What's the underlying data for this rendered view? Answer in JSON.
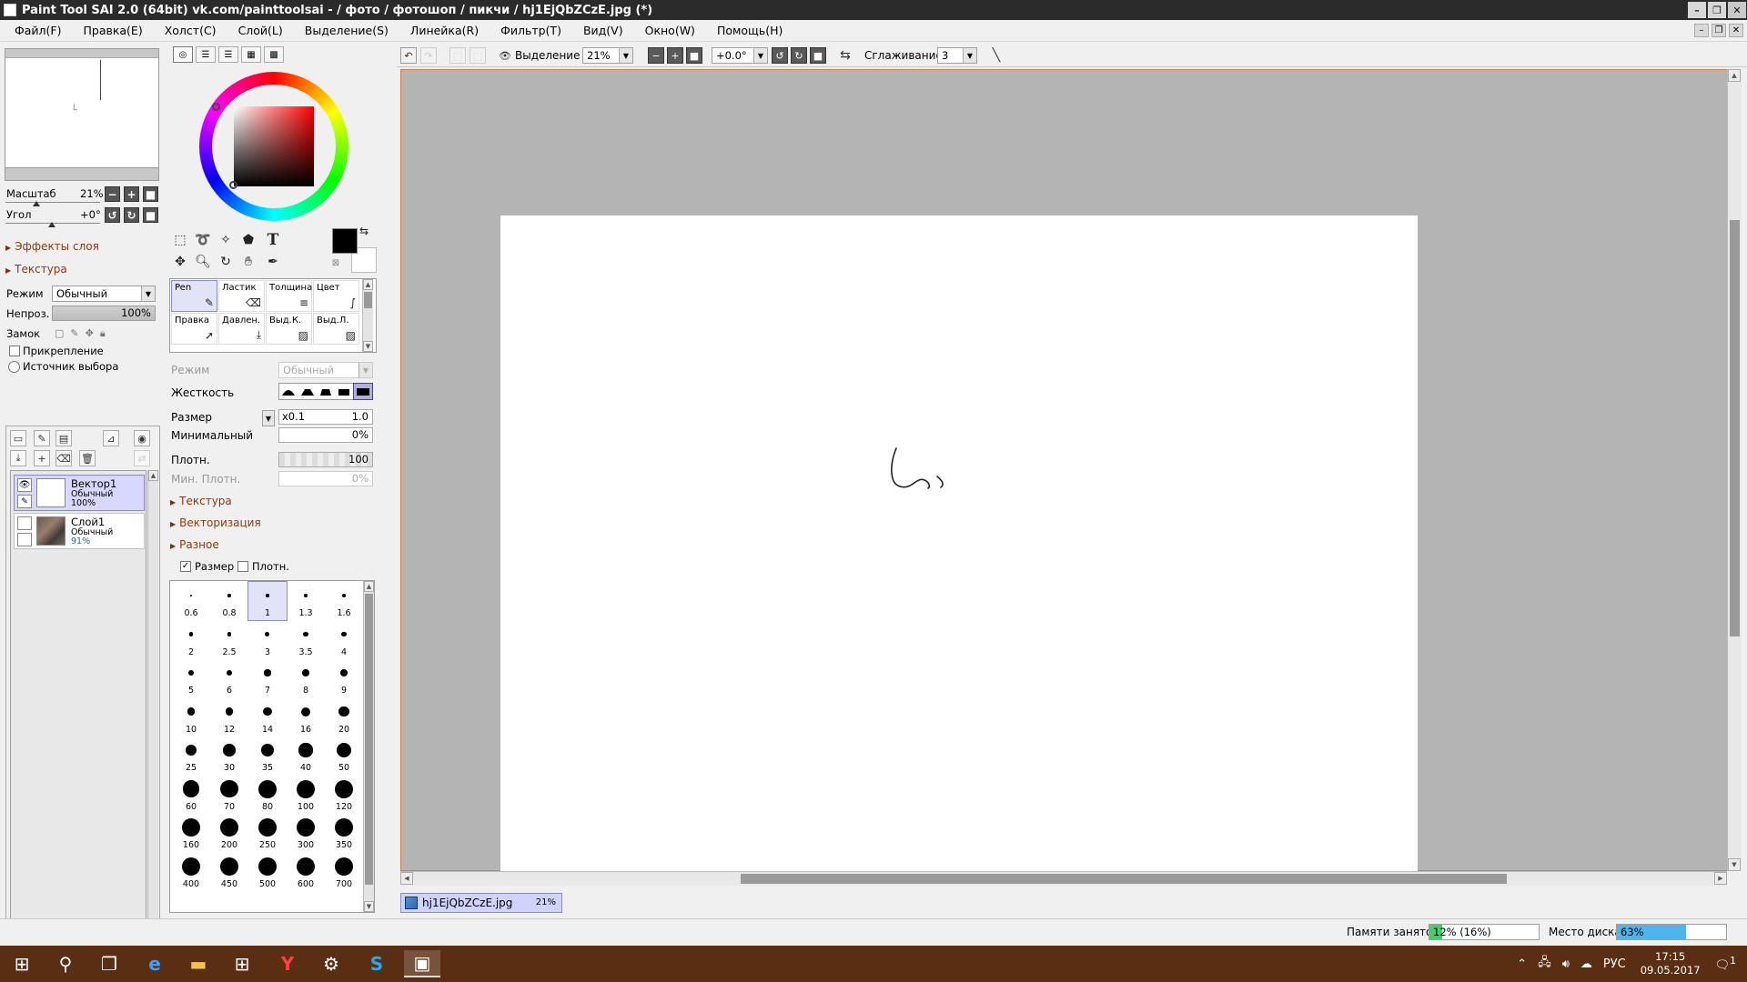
{
  "window": {
    "title": "Paint Tool SAI 2.0 (64bit) vk.com/painttoolsai -   / фото / фотошоп / пикчи / hj1EjQbZCzE.jpg (*)",
    "buttons": [
      "–",
      "❐",
      "✕"
    ]
  },
  "menu": {
    "items": [
      "Файл(F)",
      "Правка(E)",
      "Холст(C)",
      "Слой(L)",
      "Выделение(S)",
      "Линейка(R)",
      "Фильтр(T)",
      "Вид(V)",
      "Окно(W)",
      "Помощь(H)"
    ],
    "doc_buttons": [
      "–",
      "❐",
      "✕"
    ]
  },
  "navigator": {
    "scale_label": "Масштаб",
    "scale_value": "21%",
    "angle_label": "Угол",
    "angle_value": "+0°"
  },
  "layer_panel": {
    "effects": "Эффекты слоя",
    "texture": "Текстура",
    "mode_label": "Режим",
    "mode_value": "Обычный",
    "opacity_label": "Непроз.",
    "opacity_value": "100%",
    "lock_label": "Замок",
    "clip_label": "Прикрепление",
    "source_label": "Источник выбора",
    "layers": [
      {
        "name": "Вектор1",
        "mode": "Обычный",
        "opacity": "100%"
      },
      {
        "name": "Слой1",
        "mode": "Обычный",
        "opacity": "91%"
      }
    ]
  },
  "color_panel": {
    "accent_color": "#ff0000",
    "foreground": "#000000",
    "background": "#ffffff"
  },
  "brushes": {
    "row1": [
      "Pen",
      "Ластик",
      "Толщина",
      "Цвет"
    ],
    "row2": [
      "Правка",
      "Давлен.",
      "Выд.К.",
      "Выд.Л."
    ]
  },
  "brush_props": {
    "mode_label": "Режим",
    "mode_value": "Обычный",
    "hardness_label": "Жесткость",
    "size_label": "Размер",
    "size_mult": "x0.1",
    "size_value": "1.0",
    "min_label": "Минимальный",
    "min_value": "0%",
    "density_label": "Плотн.",
    "density_value": "100",
    "min_density_label": "Мин. Плотн.",
    "min_density_value": "0%",
    "texture": "Текстура",
    "vector": "Векторизация",
    "misc": "Разное",
    "chk_size": "Размер",
    "chk_density": "Плотн."
  },
  "size_presets": [
    "0.6",
    "0.8",
    "1",
    "1.3",
    "1.6",
    "2",
    "2.5",
    "3",
    "3.5",
    "4",
    "5",
    "6",
    "7",
    "8",
    "9",
    "10",
    "12",
    "14",
    "16",
    "20",
    "25",
    "30",
    "35",
    "40",
    "50",
    "60",
    "70",
    "80",
    "100",
    "120",
    "160",
    "200",
    "250",
    "300",
    "350",
    "400",
    "450",
    "500",
    "600",
    "700"
  ],
  "toolbar": {
    "selection_label": "Выделение",
    "zoom_value": "21%",
    "angle_value": "+0.0°",
    "smoothing_label": "Сглаживание",
    "smoothing_value": "3"
  },
  "file_tab": {
    "name": "hj1EjQbZCzE.jpg",
    "zoom": "21%"
  },
  "status": {
    "memory_label": "Памяти занято",
    "memory_value": "12% (16%)",
    "memory_fraction": 0.12,
    "disk_label": "Место диска",
    "disk_value": "63%",
    "disk_fraction": 0.63
  },
  "taskbar": {
    "lang": "РУС",
    "time": "17:15",
    "date": "09.05.2017",
    "notifications": "1"
  }
}
